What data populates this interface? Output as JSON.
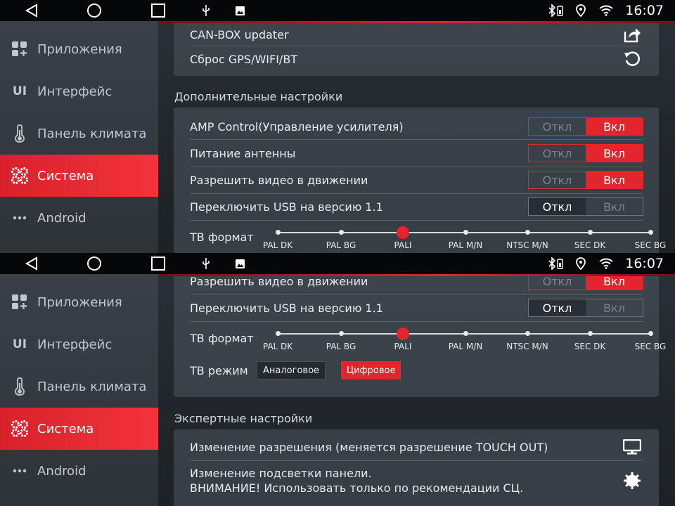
{
  "status_bar": {
    "time": "16:07"
  },
  "sidebar": {
    "items": [
      {
        "label": "Приложения",
        "icon": "apps-icon"
      },
      {
        "label": "Интерфейс",
        "icon": "ui-icon"
      },
      {
        "label": "Панель климата",
        "icon": "thermometer-icon"
      },
      {
        "label": "Система",
        "icon": "gears-icon",
        "active": true
      },
      {
        "label": "Android",
        "icon": "dots-icon"
      }
    ]
  },
  "screen1": {
    "rows_top": [
      {
        "label": "CAN-BOX updater",
        "icon": "share-icon"
      },
      {
        "label": "Сброс GPS/WIFI/BT",
        "icon": "reset-icon"
      }
    ],
    "section_title": "Дополнительные настройки",
    "toggles": [
      {
        "label": "AMP Control(Управление усилителя)",
        "off": "Откл",
        "on": "Вкл",
        "state": "on"
      },
      {
        "label": "Питание антенны",
        "off": "Откл",
        "on": "Вкл",
        "state": "on"
      },
      {
        "label": "Разрешить видео в движении",
        "off": "Откл",
        "on": "Вкл",
        "state": "on"
      },
      {
        "label": "Переключить USB на версию 1.1",
        "off": "Откл",
        "on": "Вкл",
        "state": "off"
      }
    ],
    "tv_format": {
      "label": "ТВ формат",
      "options": [
        "PAL DK",
        "PAL BG",
        "PALI",
        "PAL M/N",
        "NTSC M/N",
        "SEC DK",
        "SEC BG"
      ],
      "selected": "PALI"
    }
  },
  "screen2": {
    "partial_row": {
      "label": "Разрешить видео в движении",
      "off": "Откл",
      "on": "Вкл",
      "state": "on"
    },
    "usb_row": {
      "label": "Переключить USB на версию 1.1",
      "off": "Откл",
      "on": "Вкл",
      "state": "off"
    },
    "tv_format": {
      "label": "ТВ формат",
      "options": [
        "PAL DK",
        "PAL BG",
        "PALI",
        "PAL M/N",
        "NTSC M/N",
        "SEC DK",
        "SEC BG"
      ],
      "selected": "PALI"
    },
    "tv_mode": {
      "label": "ТВ режим",
      "analog": "Аналоговое",
      "digital": "Цифровое",
      "selected": "digital"
    },
    "expert_title": "Экспертные настройки",
    "expert_rows": [
      {
        "label": "Изменение разрешения (меняется разрешение TOUCH OUT)",
        "icon": "monitor-icon"
      },
      {
        "line1": "Изменение подсветки панели.",
        "line2": "ВНИМАНИЕ! Использовать только по рекомендации СЦ.",
        "icon": "gear-badge-icon"
      }
    ]
  },
  "colors": {
    "accent": "#e4252d",
    "background": "#22272c",
    "panel": "#4e565e"
  }
}
